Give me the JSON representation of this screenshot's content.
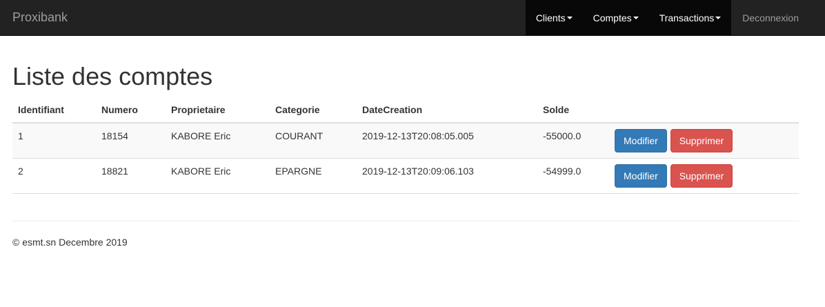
{
  "navbar": {
    "brand": "Proxibank",
    "menus": [
      {
        "label": "Clients"
      },
      {
        "label": "Comptes"
      },
      {
        "label": "Transactions"
      }
    ],
    "logout": "Deconnexion"
  },
  "page": {
    "title": "Liste des comptes"
  },
  "table": {
    "headers": [
      "Identifiant",
      "Numero",
      "Proprietaire",
      "Categorie",
      "DateCreation",
      "Solde"
    ],
    "rows": [
      {
        "id": "1",
        "numero": "18154",
        "proprietaire": "KABORE Eric",
        "categorie": "COURANT",
        "date": "2019-12-13T20:08:05.005",
        "solde": "-55000.0",
        "edit": "Modifier",
        "delete": "Supprimer"
      },
      {
        "id": "2",
        "numero": "18821",
        "proprietaire": "KABORE Eric",
        "categorie": "EPARGNE",
        "date": "2019-12-13T20:09:06.103",
        "solde": "-54999.0",
        "edit": "Modifier",
        "delete": "Supprimer"
      }
    ]
  },
  "footer": {
    "text": "© esmt.sn Decembre 2019"
  },
  "colors": {
    "navbar_bg": "#222222",
    "nav_active_bg": "#080808",
    "primary": "#337ab7",
    "danger": "#d9534f"
  },
  "icons": {
    "dropdown": "caret-down-icon"
  }
}
